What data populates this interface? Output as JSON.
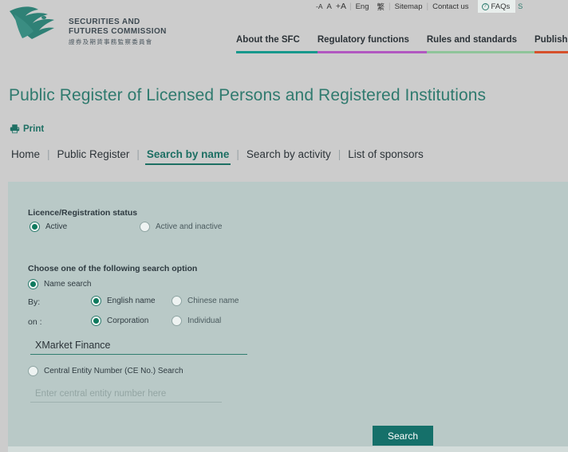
{
  "topbar": {
    "font_decrease": "-A",
    "font_normal": "A",
    "font_increase": "+A",
    "separator": "|",
    "lang_en": "Eng",
    "lang_zh": "繁",
    "sitemap": "Sitemap",
    "contact": "Contact us",
    "faqs": "FAQs",
    "faq_icon_glyph": "?",
    "edge_glyph": "S"
  },
  "logo": {
    "line1": "SECURITIES AND",
    "line2": "FUTURES COMMISSION",
    "line3": "證券及期貨事務監察委員會",
    "icon": "eagle-logo"
  },
  "mainnav": {
    "items": [
      {
        "label": "About the SFC",
        "color": "#16988c"
      },
      {
        "label": "Regulatory functions",
        "color": "#b157c0"
      },
      {
        "label": "Rules and standards",
        "color": "#8fc49a"
      },
      {
        "label": "Published resources",
        "color": "#d6502a"
      }
    ]
  },
  "page": {
    "title": "Public Register of Licensed Persons and Registered Institutions",
    "print_label": "Print"
  },
  "crumbs": {
    "separator": "|",
    "items": [
      {
        "label": "Home",
        "active": false
      },
      {
        "label": "Public Register",
        "active": false
      },
      {
        "label": "Search by name",
        "active": true
      },
      {
        "label": "Search by activity",
        "active": false
      },
      {
        "label": "List of sponsors",
        "active": false
      }
    ]
  },
  "form": {
    "status_heading": "Licence/Registration status",
    "status_active": "Active",
    "status_active_inactive": "Active and inactive",
    "search_option_heading": "Choose one of the following search option",
    "name_search": "Name search",
    "by_label": "By:",
    "on_label": "on :",
    "english_name": "English name",
    "chinese_name": "Chinese name",
    "corporation": "Corporation",
    "individual": "Individual",
    "name_value": "XMarket Finance",
    "ce_search": "Central Entity Number (CE No.) Search",
    "ce_placeholder": "Enter central entity number here",
    "ce_value": "",
    "search_button": "Search"
  },
  "colors": {
    "brand_teal": "#2f7a6e",
    "button_teal": "#15706a",
    "panel_bg": "#b9c9c7",
    "page_bg": "#cccccc"
  }
}
